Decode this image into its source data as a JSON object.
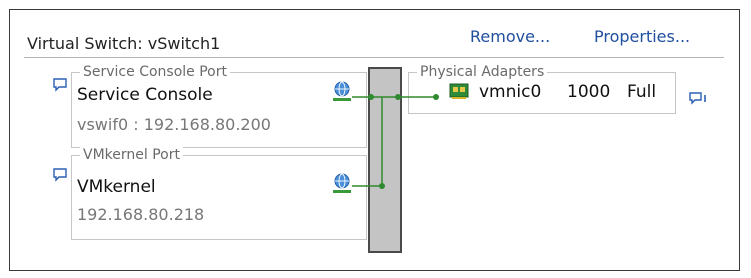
{
  "switch": {
    "title": "Virtual Switch: vSwitch1",
    "remove_label": "Remove...",
    "properties_label": "Properties..."
  },
  "service_console_group": {
    "legend": "Service Console Port",
    "name": "Service Console",
    "detail": "vswif0 : 192.168.80.200"
  },
  "vmkernel_group": {
    "legend": "VMkernel Port",
    "name": "VMkernel",
    "detail": "192.168.80.218"
  },
  "physical_adapters": {
    "legend": "Physical Adapters",
    "adapters": [
      {
        "name": "vmnic0",
        "speed": "1000",
        "duplex": "Full"
      }
    ]
  },
  "icons": {
    "comment": "speech-bubble-icon",
    "network": "network-globe-icon",
    "nic": "nic-card-icon"
  },
  "colors": {
    "link": "#1f4e9e",
    "connector": "#2f8a2f",
    "switch_bar": "#c4c4c4",
    "nic_green": "#2e8b3a"
  }
}
